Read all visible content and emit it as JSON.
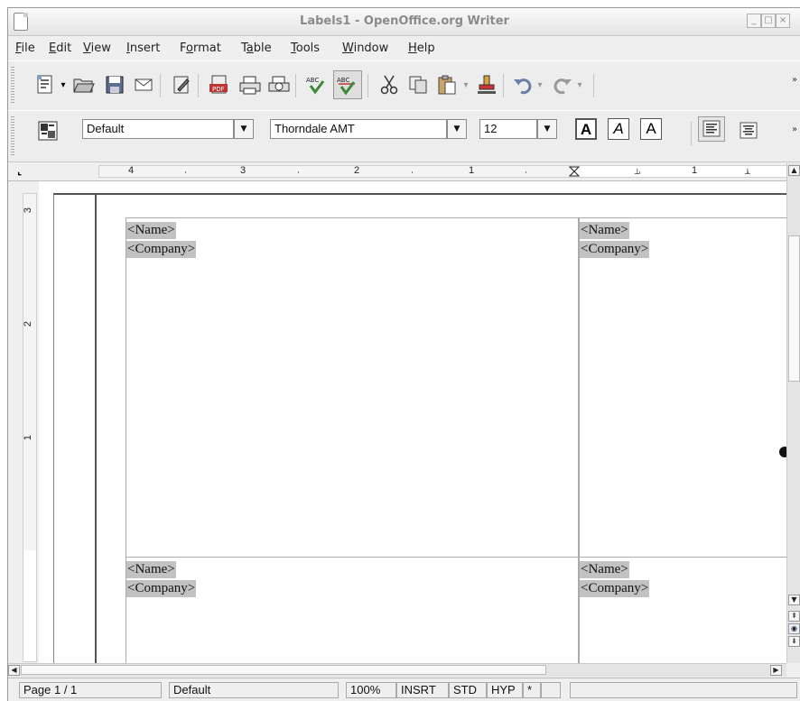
{
  "window": {
    "title": "Labels1 - OpenOffice.org Writer"
  },
  "menu": [
    {
      "label": "File",
      "accel": "F",
      "rest": "ile"
    },
    {
      "label": "Edit",
      "accel": "E",
      "rest": "dit"
    },
    {
      "label": "View",
      "accel": "V",
      "rest": "iew"
    },
    {
      "label": "Insert",
      "accel": "I",
      "rest": "nsert"
    },
    {
      "label": "Format",
      "pre": "F",
      "accel": "o",
      "rest": "rmat"
    },
    {
      "label": "Table",
      "pre": "T",
      "accel": "a",
      "rest": "ble"
    },
    {
      "label": "Tools",
      "accel": "T",
      "rest": "ools"
    },
    {
      "label": "Window",
      "accel": "W",
      "rest": "indow"
    },
    {
      "label": "Help",
      "accel": "H",
      "rest": "elp"
    }
  ],
  "standard_toolbar": {
    "icons": [
      "new-document-icon",
      "open-folder-icon",
      "save-icon",
      "email-icon",
      "edit-file-icon",
      "export-pdf-icon",
      "print-icon",
      "print-preview-icon",
      "spellcheck-icon",
      "autospellcheck-icon",
      "cut-icon",
      "copy-icon",
      "paste-icon",
      "clone-formatting-icon",
      "undo-icon",
      "redo-icon"
    ],
    "more": "»"
  },
  "formatting_toolbar": {
    "style": "Default",
    "font": "Thorndale AMT",
    "size": "12",
    "bold_label": "A",
    "italic_label": "A",
    "underline_label": "A",
    "more": "»"
  },
  "ruler": {
    "h_numbers": [
      "4",
      "3",
      "2",
      "1",
      "1"
    ],
    "v_numbers": [
      "3",
      "2",
      "1"
    ]
  },
  "labels": [
    {
      "name": "<Name>",
      "company": "<Company>"
    },
    {
      "name": "<Name>",
      "company": "<Company>"
    },
    {
      "name": "<Name>",
      "company": "<Company>"
    },
    {
      "name": "<Name>",
      "company": "<Company>"
    }
  ],
  "statusbar": {
    "page": "Page 1 / 1",
    "style": "Default",
    "zoom": "100%",
    "insert_mode": "INSRT",
    "selection_mode": "STD",
    "hyphenation": "HYP",
    "modified": "*"
  }
}
